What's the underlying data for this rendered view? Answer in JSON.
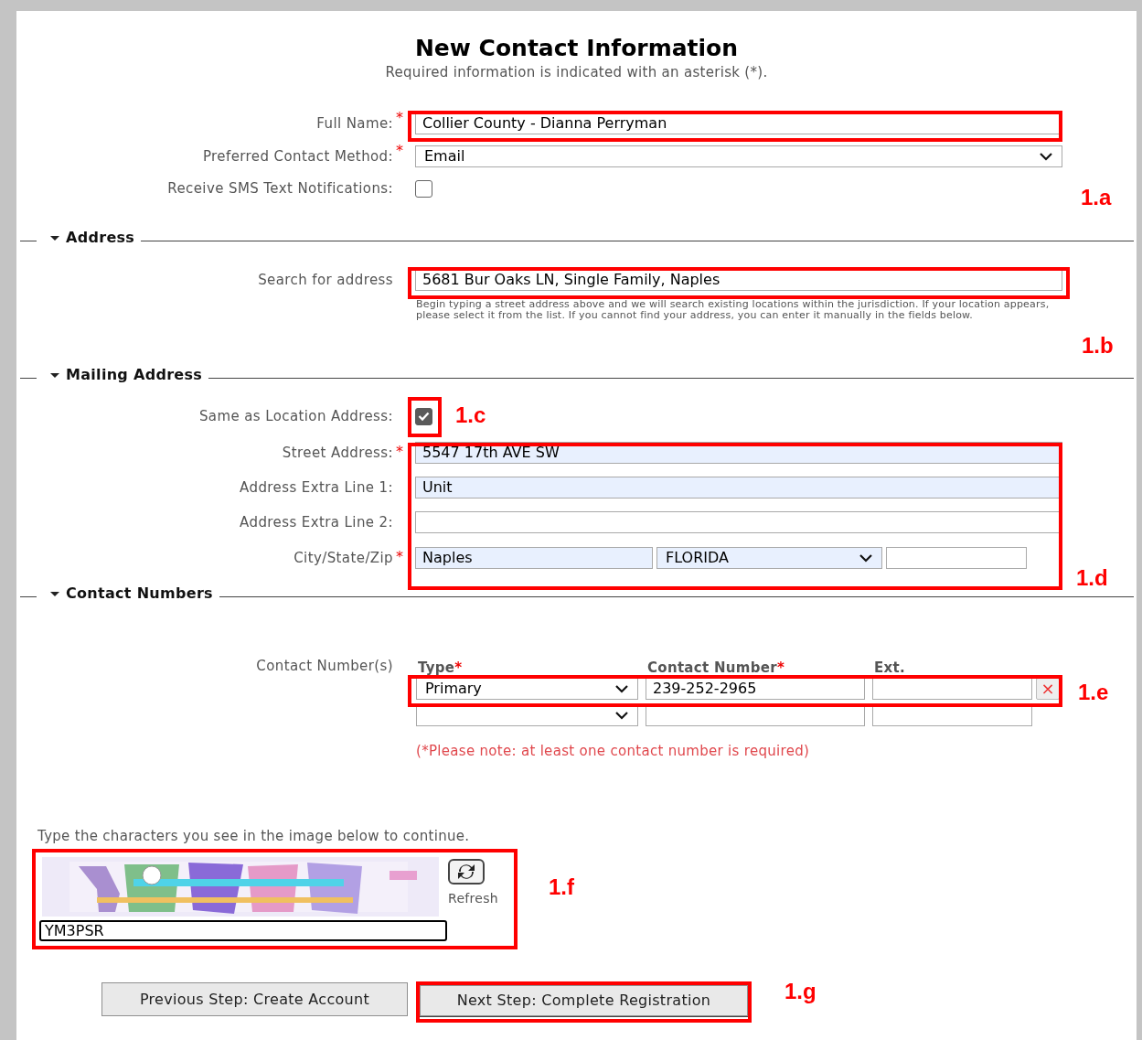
{
  "title": "New Contact Information",
  "subtitle": "Required information is indicated with an asterisk (*).",
  "contact_fields": [
    {
      "kind": "text",
      "label": "Full Name:",
      "required_mark": "*",
      "value": "Collier County - Dianna Perryman"
    },
    {
      "kind": "select",
      "label": "Preferred Contact Method:",
      "required_mark": "*",
      "value": "Email"
    },
    {
      "kind": "checkbox",
      "label": "Receive SMS Text Notifications:",
      "checked": false
    }
  ],
  "sections": [
    {
      "title": "Address",
      "expanded": true,
      "fields": [
        {
          "kind": "text",
          "label": "Search for address",
          "autofilled": false,
          "value": "5681 Bur Oaks LN, Single Family, Naples",
          "hint": "Begin typing a street address above and we will search existing locations within the jurisdiction. If your location appears, please select it from the list. If you cannot find your address, you can enter it manually in the fields below."
        }
      ]
    },
    {
      "title": "Mailing Address",
      "expanded": true,
      "fields": [
        {
          "kind": "checkbox",
          "label": "Same as Location Address:",
          "checked": true
        },
        {
          "kind": "text",
          "label": "Street Address:",
          "required_mark": "*",
          "autofilled": true,
          "value": "5547 17th AVE SW"
        },
        {
          "kind": "text",
          "label": "Address Extra Line 1:",
          "autofilled": true,
          "value": "Unit"
        },
        {
          "kind": "text",
          "label": "Address Extra Line 2:",
          "autofilled": false
        },
        {
          "kind": "city_state_zip",
          "label": "City/State/Zip",
          "required_mark": "*",
          "city": {
            "value": "Naples",
            "autofilled": true
          },
          "state": {
            "value": "FLORIDA",
            "autofilled": true
          },
          "zip": {
            "autofilled": false
          }
        }
      ]
    },
    {
      "title": "Contact Numbers",
      "expanded": true
    }
  ],
  "contact_numbers": {
    "label": "Contact Number(s)",
    "columns": [
      {
        "label": "Type",
        "required_mark": "*"
      },
      {
        "label": "Contact Number",
        "required_mark": "*"
      },
      {
        "label": "Ext."
      }
    ],
    "rows": [
      {
        "type": "Primary",
        "number": "239-252-2965",
        "remove_label": "×"
      },
      {}
    ],
    "note": "(*Please note: at least one contact number is required)"
  },
  "captcha": {
    "prompt": "Type the characters you see in the image below to continue.",
    "refresh_label": "Refresh",
    "value": "YM3PSR"
  },
  "buttons": [
    {
      "label": "Previous Step: Create Account",
      "highlighted": false
    },
    {
      "label": "Next Step: Complete Registration",
      "highlighted": true
    }
  ],
  "callouts": [
    {
      "label": "1.a"
    },
    {
      "label": "1.b"
    },
    {
      "label": "1.c"
    },
    {
      "label": "1.d"
    },
    {
      "label": "1.e"
    },
    {
      "label": "1.f"
    },
    {
      "label": "1.g"
    }
  ]
}
